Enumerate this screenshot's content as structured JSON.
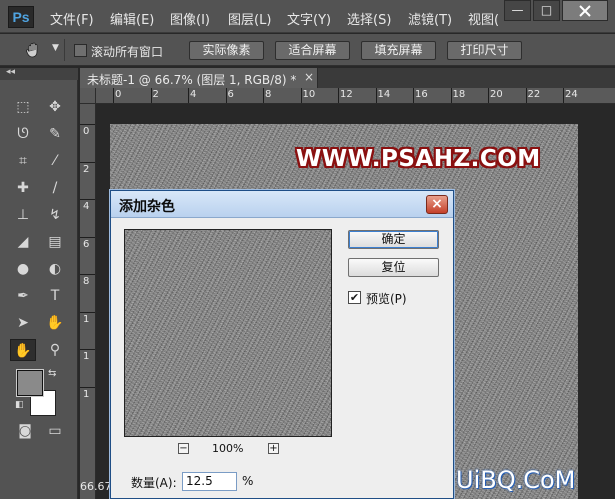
{
  "app": {
    "logo": "Ps"
  },
  "menubar": {
    "items": [
      "文件(F)",
      "编辑(E)",
      "图像(I)",
      "图层(L)",
      "文字(Y)",
      "选择(S)",
      "滤镜(T)",
      "视图("
    ],
    "window_controls": {
      "minimize": "—",
      "maximize": "□"
    }
  },
  "options": {
    "scroll_all_label": "滚动所有窗口",
    "buttons": [
      "实际像素",
      "适合屏幕",
      "填充屏幕",
      "打印尺寸"
    ]
  },
  "document": {
    "tab_title": "未标题-1 @ 66.7% (图层 1, RGB/8) *",
    "tab_close": "×",
    "zoom_status": "66.67"
  },
  "ruler": {
    "top_ticks": [
      "0",
      "2",
      "4",
      "6",
      "8",
      "10",
      "12",
      "14",
      "16",
      "18",
      "20",
      "22",
      "24"
    ],
    "left_ticks": [
      "0",
      "2",
      "4",
      "6",
      "8",
      "1",
      "1",
      "1"
    ]
  },
  "watermark": {
    "text": "WWW.PSAHZ.COM",
    "bottom_text": "UiBQ.CoM"
  },
  "dialog": {
    "title": "添加杂色",
    "close": "×",
    "ok_label": "确定",
    "reset_label": "复位",
    "preview_label": "预览(P)",
    "preview_checked": true,
    "zoom_minus": "−",
    "zoom_plus": "+",
    "zoom_value": "100%",
    "amount_label": "数量(A):",
    "amount_value": "12.5",
    "amount_unit": "%"
  },
  "toolbox": {
    "tools": [
      "marquee-icon",
      "move-icon",
      "lasso-icon",
      "quick-select-icon",
      "crop-icon",
      "eyedropper-icon",
      "healing-icon",
      "brush-icon",
      "stamp-icon",
      "history-brush-icon",
      "eraser-icon",
      "gradient-icon",
      "blur-icon",
      "dodge-icon",
      "pen-icon",
      "type-icon",
      "path-select-icon",
      "shape-icon",
      "hand-icon",
      "zoom-icon"
    ]
  },
  "colors": {
    "foreground": "#8a8a8a",
    "background": "#ffffff",
    "watermark_outline": "#8a1010"
  }
}
